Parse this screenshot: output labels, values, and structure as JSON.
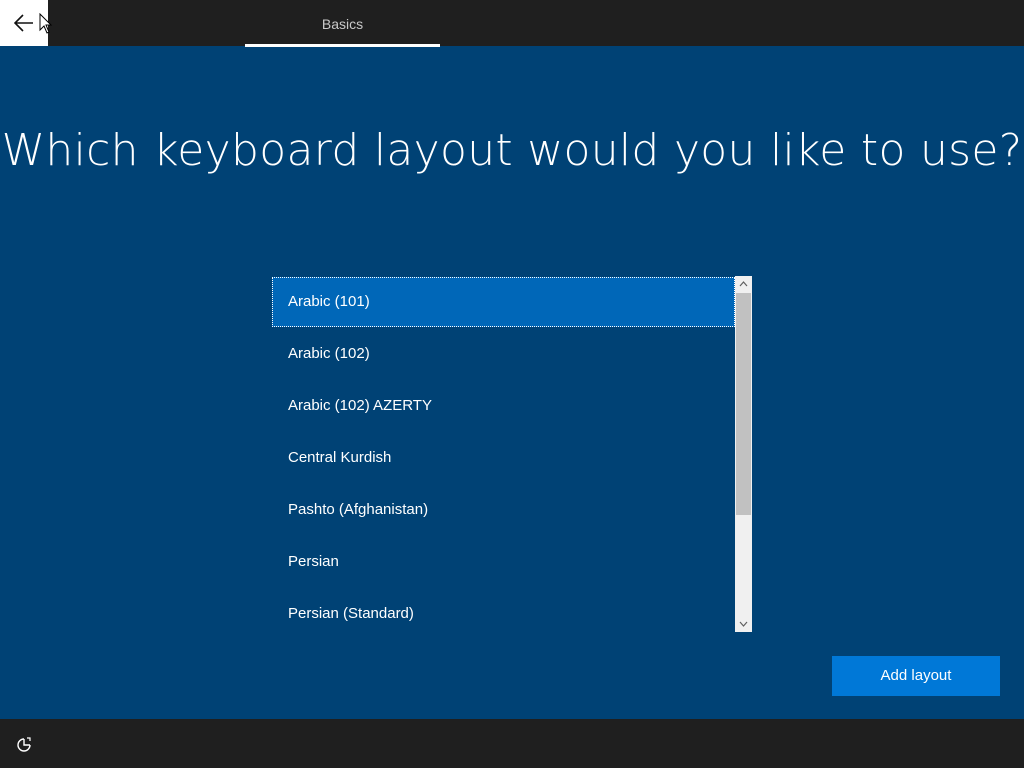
{
  "header": {
    "back_icon": "arrow-left-icon",
    "tab_label": "Basics"
  },
  "main": {
    "title": "Which keyboard layout would you like to use?",
    "layouts": [
      "Arabic (101)",
      "Arabic (102)",
      "Arabic (102) AZERTY",
      "Central Kurdish",
      "Pashto (Afghanistan)",
      "Persian",
      "Persian (Standard)"
    ],
    "selected_index": 0,
    "add_button_label": "Add layout"
  },
  "footer": {
    "accessibility_icon": "ease-of-access-icon"
  },
  "colors": {
    "background": "#004275",
    "selected_item": "#0067b8",
    "button": "#0078d7",
    "bars": "#1f1f1f"
  }
}
